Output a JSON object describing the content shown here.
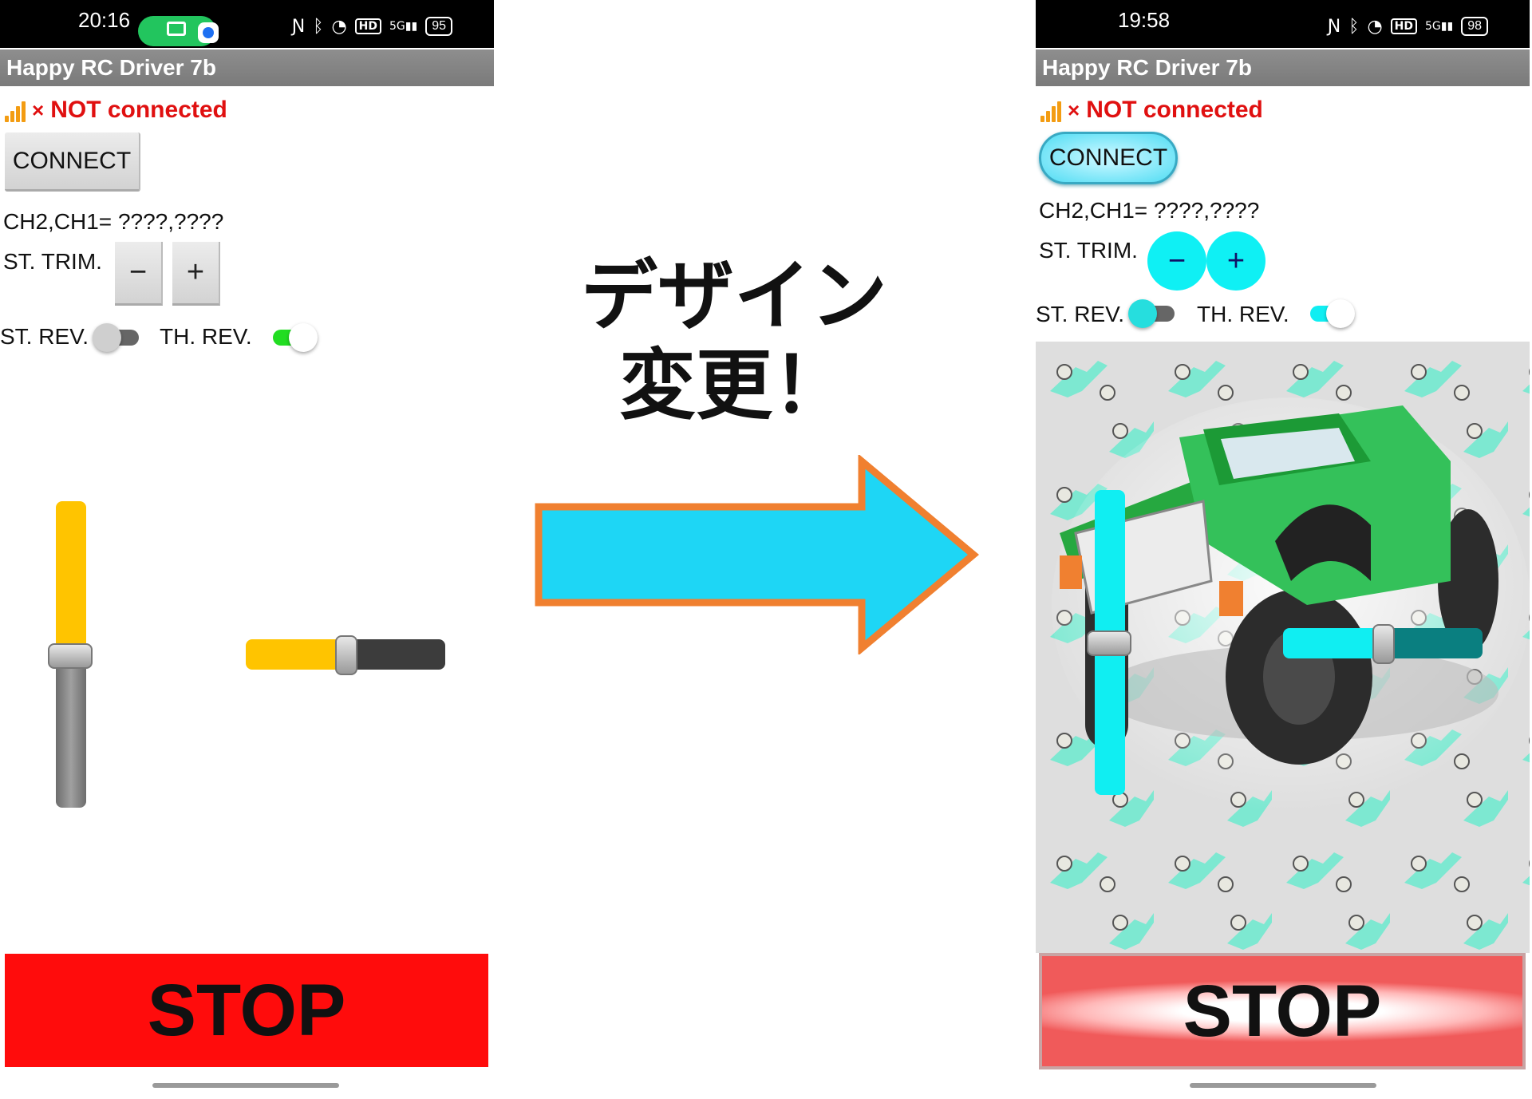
{
  "left_screen": {
    "status_bar": {
      "time": "20:16",
      "battery": "95",
      "network": "5G",
      "hd": "HD"
    },
    "title": "Happy RC Driver 7b",
    "connection_status": "NOT connected",
    "connection_x": "×",
    "connect_label": "CONNECT",
    "channel_text": "CH2,CH1= ????,????",
    "trim_label": "ST. TRIM.",
    "trim_minus": "−",
    "trim_plus": "+",
    "st_rev_label": "ST. REV.",
    "th_rev_label": "TH. REV.",
    "st_rev_on": false,
    "th_rev_on": true,
    "throttle_level": 0.5,
    "steering_level": 0.5,
    "stop_label": "STOP",
    "colors": {
      "accent": "#ffc400",
      "switch_on": "#22dd22",
      "stop": "#ff0c0c"
    }
  },
  "headline": {
    "line1": "デザイン",
    "line2": "変更！"
  },
  "right_screen": {
    "status_bar": {
      "time": "19:58",
      "battery": "98",
      "network": "5G",
      "hd": "HD"
    },
    "title": "Happy RC Driver 7b",
    "connection_status": "NOT connected",
    "connection_x": "×",
    "connect_label": "CONNECT",
    "channel_text": "CH2,CH1= ????,????",
    "trim_label": "ST. TRIM.",
    "trim_minus": "−",
    "trim_plus": "+",
    "st_rev_label": "ST. REV.",
    "th_rev_label": "TH. REV.",
    "st_rev_on": false,
    "th_rev_on": true,
    "throttle_level": 0.5,
    "steering_level": 0.5,
    "stop_label": "STOP",
    "colors": {
      "accent": "#10eef2",
      "background_car": "#2fb84c"
    }
  }
}
